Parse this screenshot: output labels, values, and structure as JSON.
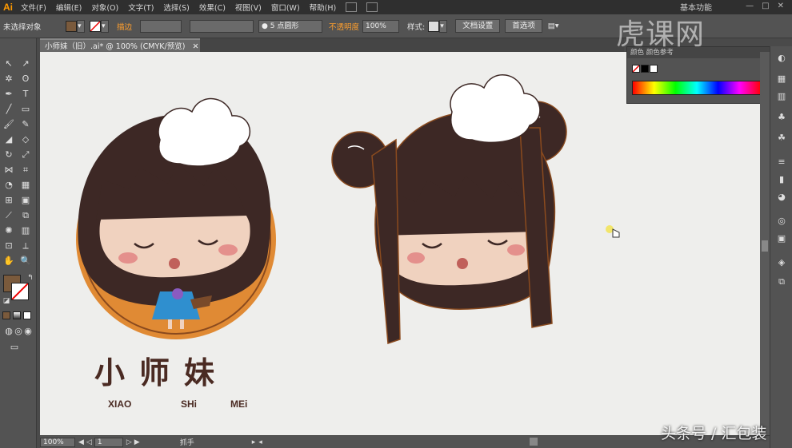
{
  "menubar": {
    "app_logo": "Ai",
    "items": [
      "文件(F)",
      "编辑(E)",
      "对象(O)",
      "文字(T)",
      "选择(S)",
      "效果(C)",
      "视图(V)",
      "窗口(W)",
      "帮助(H)"
    ],
    "workspace": "基本功能"
  },
  "controlbar": {
    "selection_status": "未选择对象",
    "stroke_label": "描边",
    "brush_size": "5 点圆形",
    "opacity_label": "不透明度",
    "opacity_value": "100%",
    "style_label": "样式:",
    "doc_setup_button": "文档设置",
    "preferences_button": "首选项"
  },
  "document": {
    "tab_title": "小师妹（旧）.ai* @ 100% (CMYK/预览)"
  },
  "color_panel": {
    "tabs": "颜色  颜色参考"
  },
  "artwork": {
    "logo_chinese": "小师妹",
    "pinyin_1": "XIAO",
    "pinyin_2": "SHi",
    "pinyin_3": "MEi"
  },
  "statusbar": {
    "zoom": "100%",
    "page": "1",
    "tool_name": "抓手"
  },
  "watermarks": {
    "top": "虎课网",
    "bottom": "头条号 / 汇包装"
  },
  "colors": {
    "hair": "#3d2825",
    "skin": "#f0d2bf",
    "blush": "#e4908c",
    "orange_circle": "#e08a34",
    "dress": "#2f8fcf",
    "accent_ui": "#ff9f2e"
  }
}
